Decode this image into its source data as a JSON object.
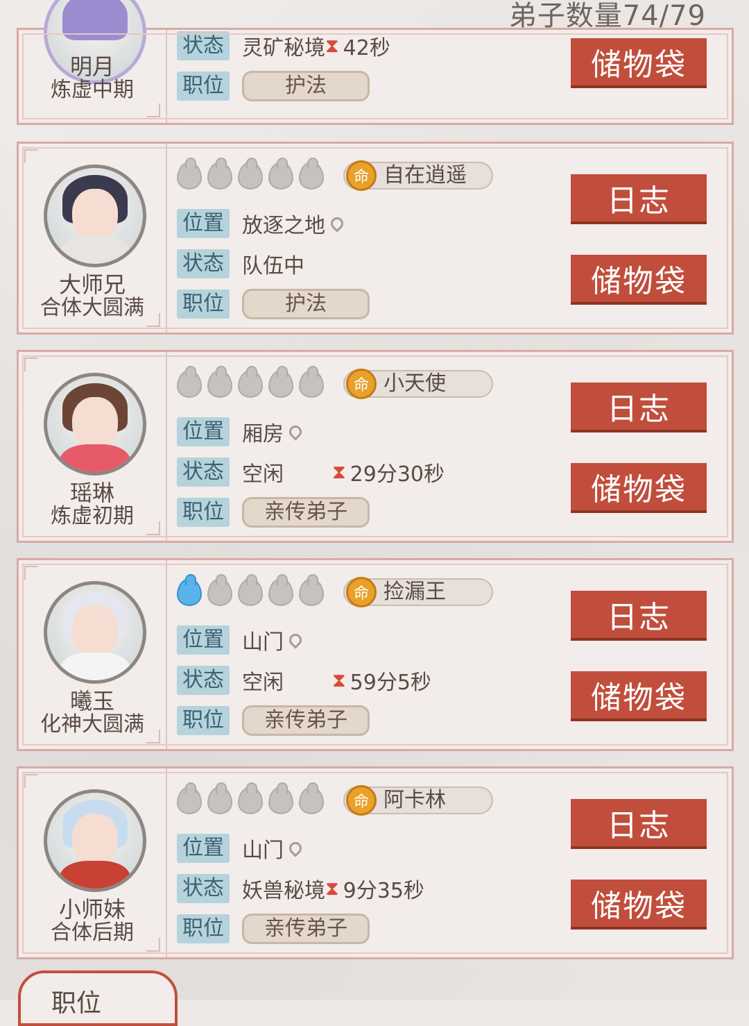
{
  "header": {
    "disciple_count": "弟子数量74/79"
  },
  "labels": {
    "position": "位置",
    "status": "状态",
    "role": "职位"
  },
  "buttons": {
    "log": "日志",
    "bag": "储物袋"
  },
  "disciples": [
    {
      "name": "明月",
      "realm": "炼虚中期",
      "status": "灵矿秘境",
      "timer": "42秒",
      "role": "护法"
    },
    {
      "name": "大师兄",
      "realm": "合体大圆满",
      "trait": "自在逍遥",
      "location": "放逐之地",
      "status": "队伍中",
      "timer": "",
      "role": "护法",
      "lit_orbs": 0
    },
    {
      "name": "瑶琳",
      "realm": "炼虚初期",
      "trait": "小天使",
      "location": "厢房",
      "status": "空闲",
      "timer": "29分30秒",
      "role": "亲传弟子",
      "lit_orbs": 0
    },
    {
      "name": "曦玉",
      "realm": "化神大圆满",
      "trait": "捡漏王",
      "location": "山门",
      "status": "空闲",
      "timer": "59分5秒",
      "role": "亲传弟子",
      "lit_orbs": 1
    },
    {
      "name": "小师妹",
      "realm": "合体后期",
      "trait": "阿卡林",
      "location": "山门",
      "status": "妖兽秘境",
      "timer": "9分35秒",
      "role": "亲传弟子",
      "lit_orbs": 0
    }
  ],
  "trait_icon_glyph": "命",
  "bottom_tab": {
    "label": "职位"
  },
  "colors": {
    "button": "#c14e3c",
    "tag_bg": "#b5d3dc",
    "card_border": "#d9a9a4"
  }
}
